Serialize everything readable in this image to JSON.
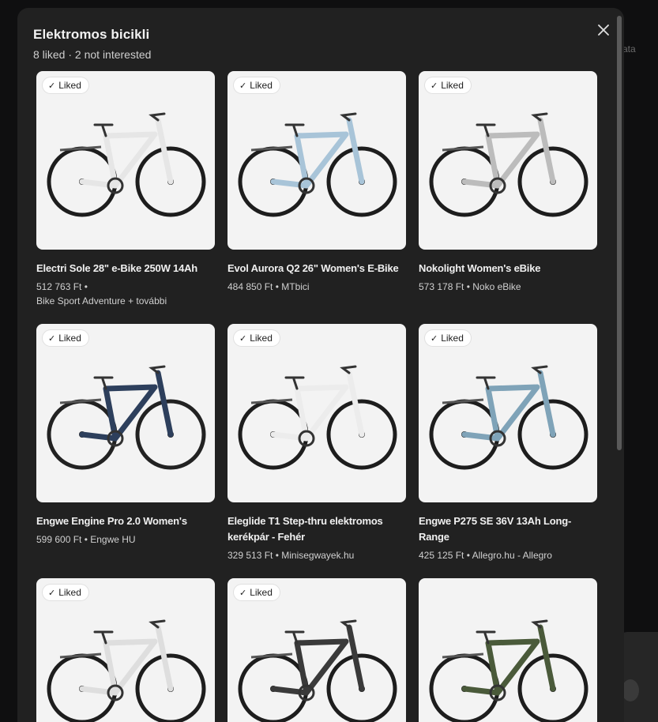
{
  "backdrop": {
    "side_text": "ata"
  },
  "dialog": {
    "title": "Elektromos bicikli",
    "subtitle": "8 liked · 2 not interested",
    "close_icon": "close-icon"
  },
  "badge": {
    "check": "✓",
    "label": "Liked"
  },
  "products": [
    {
      "title": "Electri Sole 28\" e-Bike 250W 14Ah",
      "price_line": "512 763 Ft •",
      "seller": "Bike Sport Adventure + további",
      "liked": true,
      "frame_color": "#e6e6e6",
      "tire_color": "#1d1d1d"
    },
    {
      "title": "Evol Aurora Q2 26\" Women's E-Bike",
      "price_line": "484 850 Ft • MTbici",
      "seller": "",
      "liked": true,
      "frame_color": "#a8c4d8",
      "tire_color": "#1d1d1d"
    },
    {
      "title": "Nokolight Women's eBike",
      "price_line": "573 178 Ft • Noko eBike",
      "seller": "",
      "liked": true,
      "frame_color": "#bcbcbc",
      "tire_color": "#1d1d1d"
    },
    {
      "title": "Engwe Engine Pro 2.0 Women's",
      "price_line": "599 600 Ft • Engwe HU",
      "seller": "",
      "liked": true,
      "frame_color": "#2d3f5c",
      "tire_color": "#222222"
    },
    {
      "title": "Eleglide T1 Step-thru elektromos kerékpár - Fehér",
      "price_line": "329 513 Ft • Minisegwayek.hu",
      "seller": "",
      "liked": true,
      "frame_color": "#ececec",
      "tire_color": "#1d1d1d"
    },
    {
      "title": "Engwe P275 SE 36V 13Ah Long-Range",
      "price_line": "425 125 Ft • Allegro.hu - Allegro",
      "seller": "",
      "liked": true,
      "frame_color": "#7fa3b8",
      "tire_color": "#1d1d1d"
    },
    {
      "title": "",
      "price_line": "",
      "seller": "",
      "liked": true,
      "frame_color": "#dedede",
      "tire_color": "#1d1d1d"
    },
    {
      "title": "",
      "price_line": "",
      "seller": "",
      "liked": true,
      "frame_color": "#3a3a3a",
      "tire_color": "#1d1d1d"
    },
    {
      "title": "",
      "price_line": "",
      "seller": "",
      "liked": false,
      "frame_color": "#4a5a3a",
      "tire_color": "#1d1d1d"
    }
  ]
}
